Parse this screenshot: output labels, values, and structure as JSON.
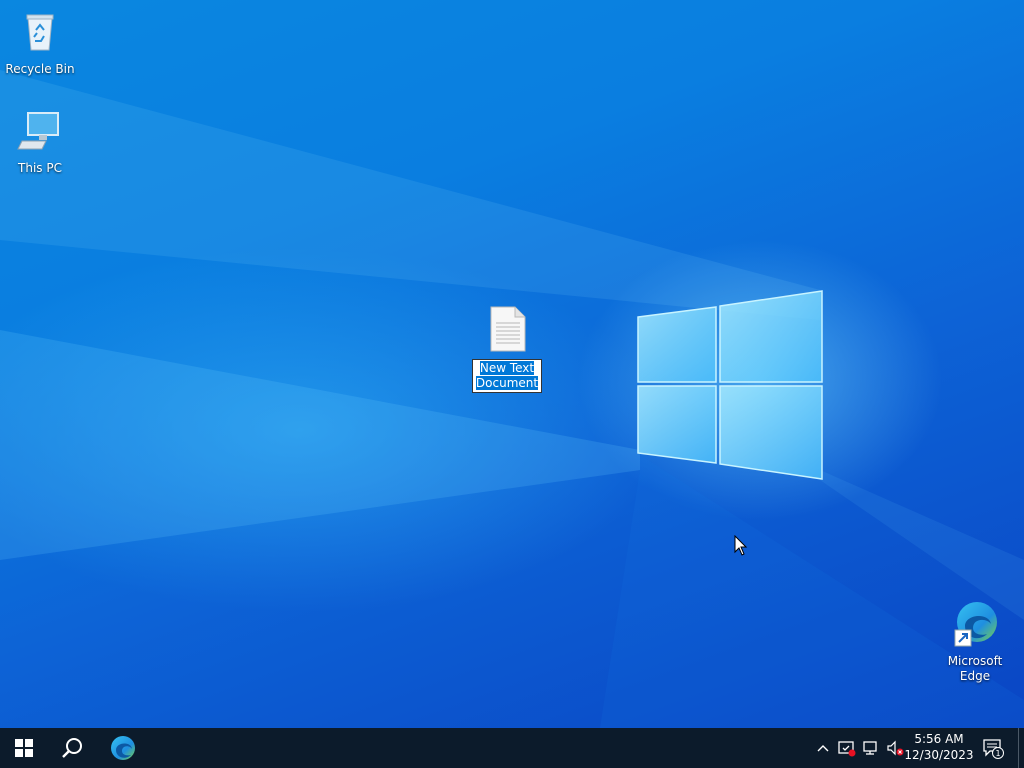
{
  "desktop": {
    "icons": [
      {
        "label": "Recycle Bin",
        "icon": "recycle-bin-icon"
      },
      {
        "label": "This PC",
        "icon": "computer-icon"
      },
      {
        "label": "New Text Document",
        "line1": "New Text",
        "line2": "Document",
        "icon": "text-document-icon",
        "renaming": true
      },
      {
        "label": "Microsoft Edge",
        "line1": "Microsoft",
        "line2": "Edge",
        "icon": "edge-shortcut-icon"
      }
    ]
  },
  "taskbar": {
    "start": "windows-start-icon",
    "search": "search-icon",
    "pinned": [
      "edge-icon"
    ],
    "tray": {
      "icons": [
        "chevron-up-icon",
        "security-warning-icon",
        "network-disconnected-icon",
        "volume-muted-icon"
      ],
      "time": "5:56 AM",
      "date": "12/30/2023",
      "notification_count": "1"
    }
  },
  "colors": {
    "desktop_blue": "#0a7ee0",
    "taskbar": "#0c1b2b",
    "selection": "#0078d7"
  }
}
